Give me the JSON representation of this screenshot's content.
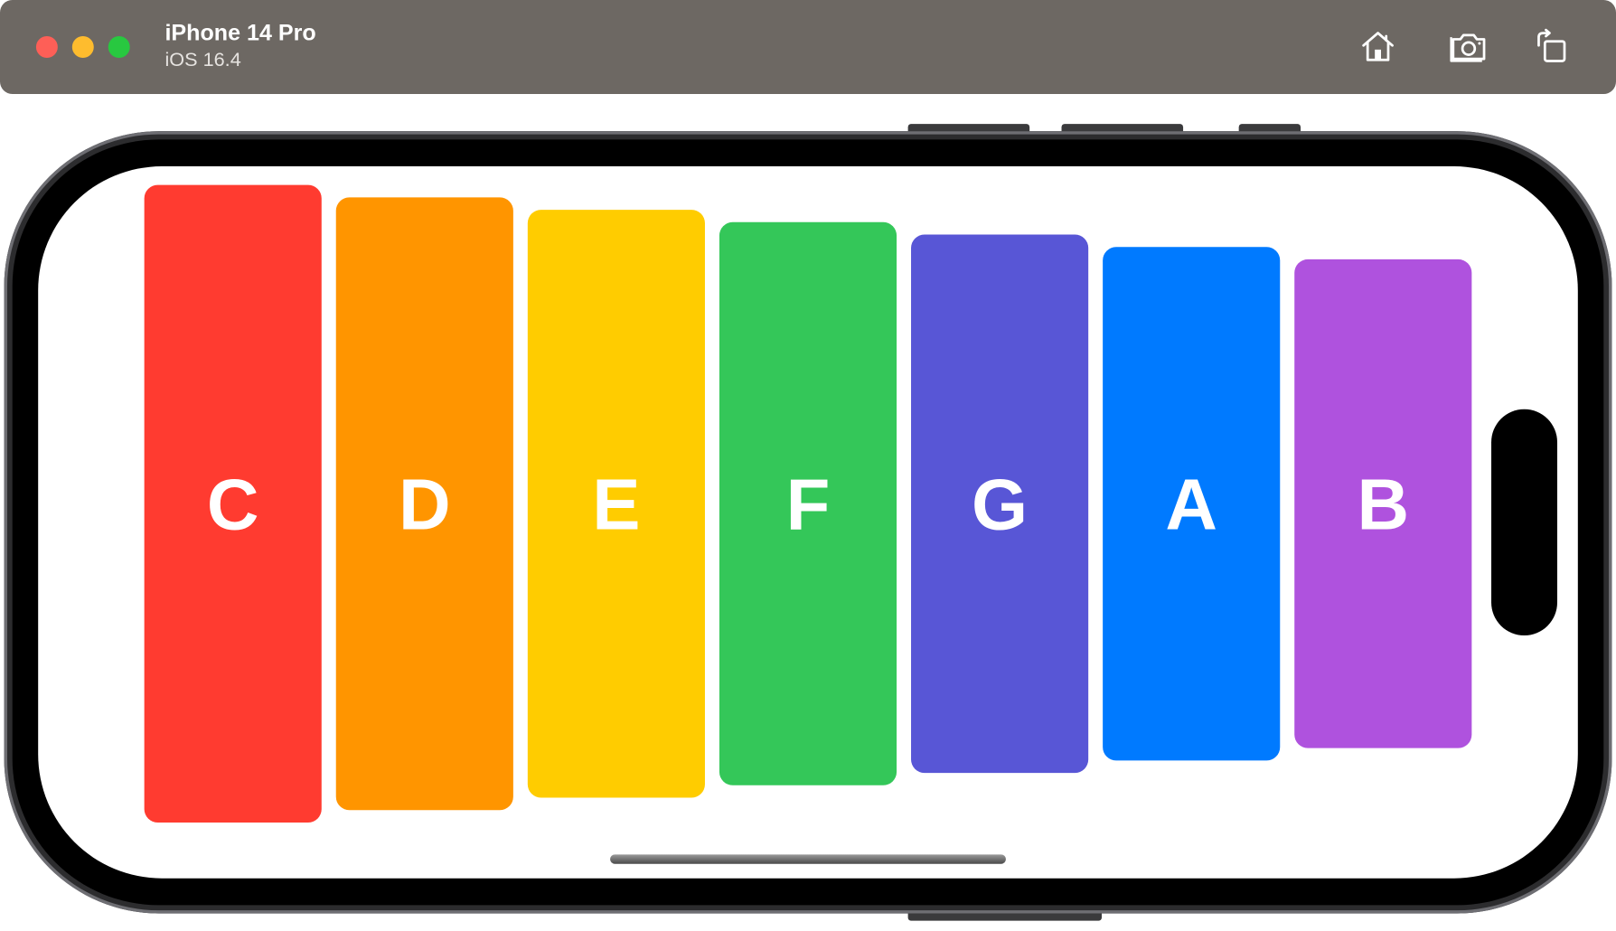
{
  "window": {
    "device_name": "iPhone 14 Pro",
    "os_version": "iOS 16.4"
  },
  "toolbar": {
    "icons": [
      "home-icon",
      "screenshot-icon",
      "rotate-icon"
    ]
  },
  "app": {
    "keys": [
      {
        "label": "C",
        "color": "#ff3b30"
      },
      {
        "label": "D",
        "color": "#ff9500"
      },
      {
        "label": "E",
        "color": "#ffcc00"
      },
      {
        "label": "F",
        "color": "#34c759"
      },
      {
        "label": "G",
        "color": "#5856d6"
      },
      {
        "label": "A",
        "color": "#007aff"
      },
      {
        "label": "B",
        "color": "#af52de"
      }
    ]
  }
}
